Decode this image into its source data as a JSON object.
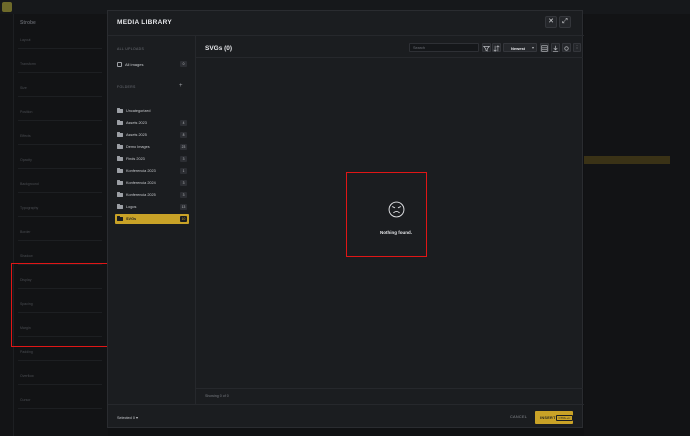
{
  "background": {
    "panel_title": "Strobe",
    "panel_rows": [
      "Layout",
      "Transform",
      "Size",
      "Position",
      "Effects",
      "Opacity",
      "Background",
      "Typography",
      "Border",
      "Shadow",
      "Display",
      "Spacing",
      "Margin",
      "Padding",
      "Overflow",
      "Cursor"
    ]
  },
  "modal": {
    "title": "MEDIA LIBRARY",
    "close_glyph": "✕",
    "expand_glyph": "⤢"
  },
  "sidebar": {
    "all_uploads_label": "ALL UPLOADS",
    "all_images": {
      "label": "All images",
      "count": "0"
    },
    "folders_label": "FOLDERS",
    "add_glyph": "+",
    "folders": [
      {
        "label": "Uncategorized",
        "count": "",
        "active": false
      },
      {
        "label": "Assets 2023",
        "count": "4",
        "active": false
      },
      {
        "label": "Assets 2025",
        "count": "8",
        "active": false
      },
      {
        "label": "Demo Images",
        "count": "23",
        "active": false
      },
      {
        "label": "Finds 2023",
        "count": "3",
        "active": false
      },
      {
        "label": "Konferencia 2023",
        "count": "1",
        "active": false
      },
      {
        "label": "Konferencia 2024",
        "count": "3",
        "active": false
      },
      {
        "label": "Konferencia 2025",
        "count": "3",
        "active": false
      },
      {
        "label": "Logos",
        "count": "13",
        "active": false
      },
      {
        "label": "SVGs",
        "count": "10",
        "active": true
      }
    ]
  },
  "main": {
    "heading": "SVGs (0)",
    "search_placeholder": "Search",
    "sort_label": "Newest",
    "empty_message": "Nothing found.",
    "showing": "Showing 0 of 0"
  },
  "footer": {
    "selected": "Selected 0",
    "cancel": "CANCEL",
    "insert": "INSERT",
    "insert_kbd": "CTRL+↵"
  },
  "colors": {
    "accent": "#c9a227",
    "annotation": "#e01616"
  }
}
